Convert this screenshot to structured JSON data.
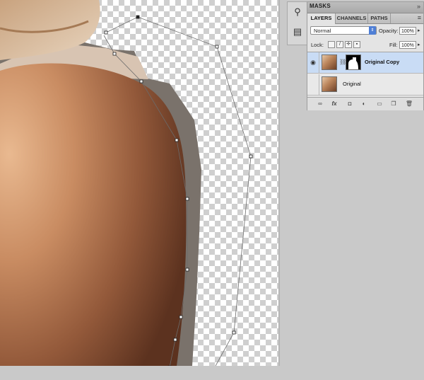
{
  "panel": {
    "masks_tab": "MASKS",
    "tabs": [
      "LAYERS",
      "CHANNELS",
      "PATHS"
    ],
    "active_tab": "LAYERS",
    "blend_mode": "Normal",
    "opacity_label": "Opacity:",
    "opacity_value": "100%",
    "lock_label": "Lock:",
    "fill_label": "Fill:",
    "fill_value": "100%",
    "layers": [
      {
        "name": "Original Copy",
        "visible": true,
        "selected": true,
        "has_mask": true
      },
      {
        "name": "Original",
        "visible": false,
        "selected": false,
        "has_mask": false
      }
    ],
    "bottom_icons": [
      "link-icon",
      "fx-icon",
      "add-mask-icon",
      "adjustment-icon",
      "folder-icon",
      "new-layer-icon",
      "trash-icon"
    ]
  },
  "colors": {
    "workspace": "#c9c9c9",
    "selected_layer": "#c9dcf5",
    "accent": "#4f7fd6"
  }
}
